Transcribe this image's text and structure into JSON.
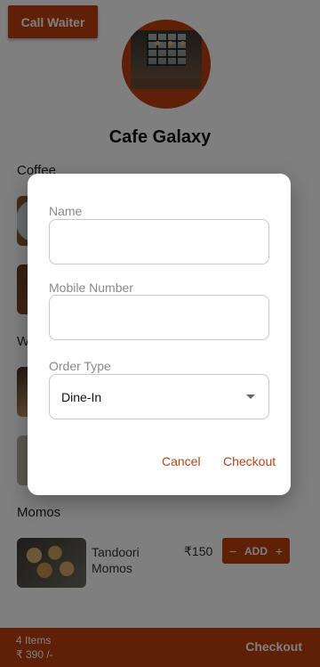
{
  "colors": {
    "accent": "#c1410f",
    "overlay": "rgba(0,0,0,0.5)"
  },
  "header": {
    "call_waiter_label": "Call Waiter",
    "cafe_name": "Cafe Galaxy"
  },
  "sections": {
    "coffee": {
      "title": "Coffee"
    },
    "wraps": {
      "title": "W"
    },
    "momos": {
      "title": "Momos"
    }
  },
  "menu_item": {
    "name": "Tandoori Momos",
    "price": "₹150",
    "add_label": "ADD",
    "decrement": "−",
    "increment": "+"
  },
  "cart_bar": {
    "count": "4 Items",
    "total": "₹ 390 /-",
    "checkout_label": "Checkout"
  },
  "dialog": {
    "name_label": "Name",
    "name_value": "",
    "mobile_label": "Mobile Number",
    "mobile_value": "",
    "order_type_label": "Order Type",
    "order_type_value": "Dine-In",
    "cancel_label": "Cancel",
    "checkout_label": "Checkout"
  }
}
